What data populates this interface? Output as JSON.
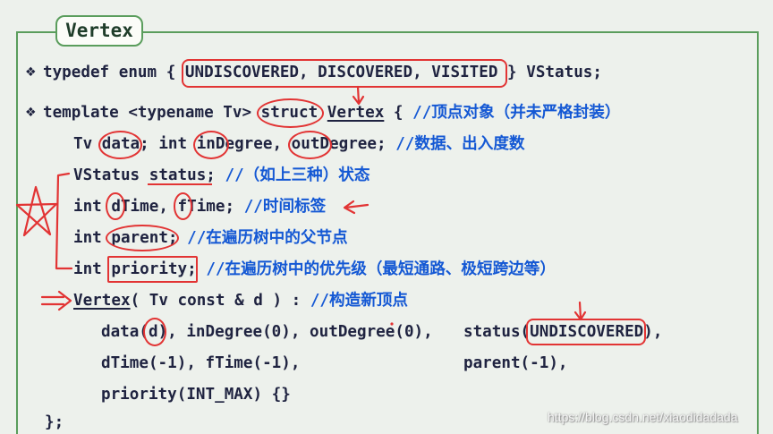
{
  "slide": {
    "title": "Vertex",
    "watermark": "https://blog.csdn.net/xiaodidadada"
  },
  "code": {
    "line_typedef": [
      "typedef enum { ",
      "UNDISCOVERED, DISCOVERED, VISITED",
      " } VStatus;"
    ],
    "line_template": [
      "template <typename Tv> ",
      "struct",
      " ",
      "Vertex",
      " { ",
      "//顶点对象（并未严格封装）"
    ],
    "line_fields": [
      "Tv ",
      "data",
      "; int ",
      "inD",
      "egree, ",
      "outD",
      "egree; ",
      "//数据、出入度数"
    ],
    "line_status": [
      "VStatus ",
      "status;",
      " ",
      "//（如上三种）状态"
    ],
    "line_time": [
      "int ",
      "d",
      "Time, ",
      "f",
      "Time; ",
      "//时间标签"
    ],
    "line_parent": [
      "int ",
      "parent;",
      " ",
      "//在遍历树中的父节点"
    ],
    "line_priority": [
      "int ",
      "priority;",
      " ",
      "//在遍历树中的优先级（最短通路、极短跨边等）"
    ],
    "line_ctor": [
      "Vertex",
      "( Tv const & d ) : ",
      "//构造新顶点"
    ],
    "line_init_a": [
      "data(",
      "d",
      "), inDegree(0), outDegree(0),"
    ],
    "line_init_a_right": [
      "status(",
      "UNDISCOVERED",
      "),"
    ],
    "line_init_b": [
      "dTime(-1), fTime(-1),"
    ],
    "line_init_b_right": [
      "parent(-1),"
    ],
    "line_init_c": [
      "priority(INT_MAX) {}"
    ],
    "line_close": [
      "};"
    ]
  },
  "icons": {
    "bullet": "four-diamond-bullet-icon",
    "annotations": [
      "red-down-arrow-icon",
      "red-left-arrow-icon",
      "red-double-arrow-icon",
      "red-star-icon",
      "red-bracket-mark",
      "red-dot-mark"
    ]
  },
  "colors": {
    "background": "#edf1ec",
    "frame": "#5a9d5c",
    "title_text": "#1f3d2a",
    "code_text": "#1f2340",
    "comment_text": "#1458d4",
    "annotation_red": "#e23434"
  }
}
